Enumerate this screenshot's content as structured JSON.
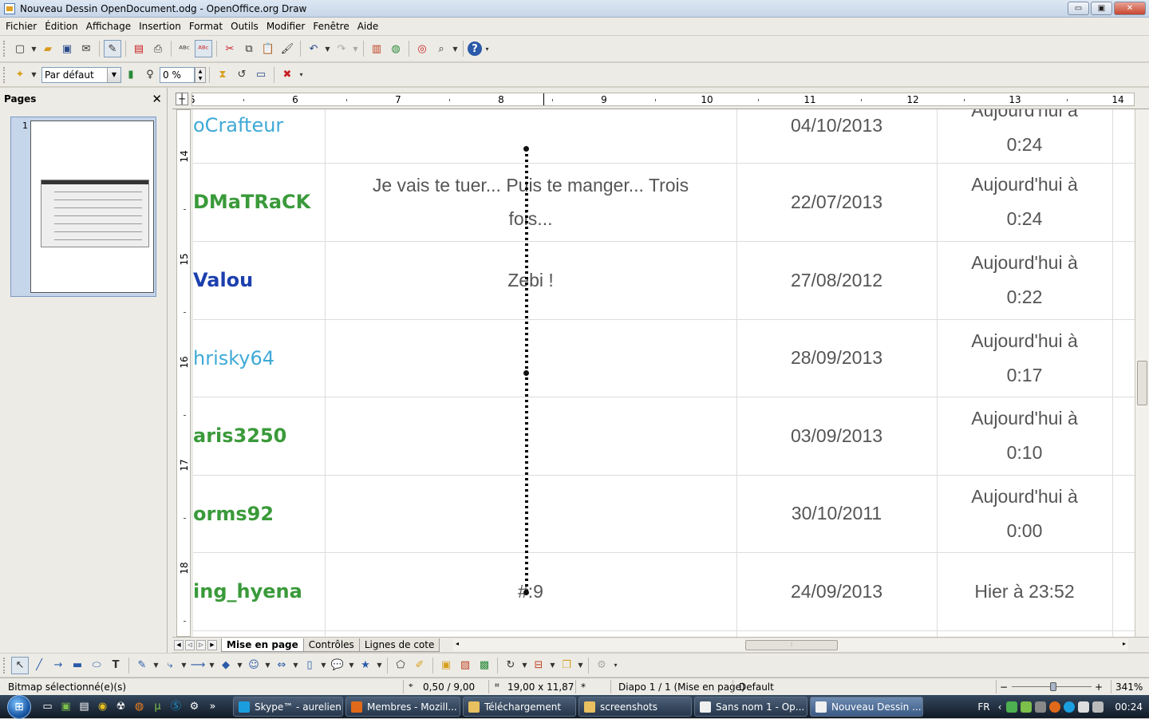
{
  "window": {
    "title": "Nouveau Dessin OpenDocument.odg - OpenOffice.org Draw",
    "btn_min": "▭",
    "btn_max": "▣",
    "btn_close": "✕"
  },
  "menu": [
    "Fichier",
    "Édition",
    "Affichage",
    "Insertion",
    "Format",
    "Outils",
    "Modifier",
    "Fenêtre",
    "Aide"
  ],
  "toolbar2": {
    "style_value": "Par défaut",
    "transparency_value": "0 %"
  },
  "pages_panel": {
    "title": "Pages",
    "close": "✕",
    "page_number": "1"
  },
  "ruler": {
    "h_labels": [
      "5",
      "6",
      "7",
      "8",
      "9",
      "10",
      "11",
      "12",
      "13",
      "14"
    ],
    "v_labels": [
      "14",
      "15",
      "16",
      "17",
      "18"
    ]
  },
  "table": {
    "rows": [
      {
        "user": "oCrafteur",
        "user_color": "#3fa9d6",
        "user_bold": false,
        "message": "",
        "date": "04/10/2013",
        "last_line1": "Aujourd'hui à",
        "last_line2": "0:24"
      },
      {
        "user": "DMaTRaCK",
        "user_color": "#3a9a3a",
        "user_bold": true,
        "message": "Je vais te tuer... Puis te manger... Trois fois...",
        "date": "22/07/2013",
        "last_line1": "Aujourd'hui à",
        "last_line2": "0:24"
      },
      {
        "user": "Valou",
        "user_color": "#1c3fae",
        "user_bold": true,
        "message": "Zebi !",
        "date": "27/08/2012",
        "last_line1": "Aujourd'hui à",
        "last_line2": "0:22"
      },
      {
        "user": "hrisky64",
        "user_color": "#3fa9d6",
        "user_bold": false,
        "message": "",
        "date": "28/09/2013",
        "last_line1": "Aujourd'hui à",
        "last_line2": "0:17"
      },
      {
        "user": "aris3250",
        "user_color": "#3a9a3a",
        "user_bold": true,
        "message": "",
        "date": "03/09/2013",
        "last_line1": "Aujourd'hui à",
        "last_line2": "0:10"
      },
      {
        "user": "orms92",
        "user_color": "#3a9a3a",
        "user_bold": true,
        "message": "",
        "date": "30/10/2011",
        "last_line1": "Aujourd'hui à",
        "last_line2": "0:00"
      },
      {
        "user": "ing_hyena",
        "user_color": "#3a9a3a",
        "user_bold": true,
        "message": "#:9",
        "date": "24/09/2013",
        "last_line1": "Hier à 23:52",
        "last_line2": ""
      }
    ]
  },
  "layer_tabs": [
    "Mise en page",
    "Contrôles",
    "Lignes de cote"
  ],
  "statusbar": {
    "selection": "Bitmap sélectionné(e)(s)",
    "position": "0,50 / 9,00",
    "size": "19,00 x 11,87",
    "modified": "*",
    "slide": "Diapo 1 / 1 (Mise en page)",
    "layout": "Default",
    "zoom_minus": "−",
    "zoom_plus": "+",
    "zoom": "341%"
  },
  "taskbar": {
    "tasks": [
      {
        "label": "Skype™ - aurelien...",
        "icon_color": "#1a9ee0"
      },
      {
        "label": "Membres - Mozill...",
        "icon_color": "#e06a1a"
      },
      {
        "label": "Téléchargement",
        "icon_color": "#e8c060"
      },
      {
        "label": "screenshots",
        "icon_color": "#e8c060"
      },
      {
        "label": "Sans nom 1 - Op...",
        "icon_color": "#f0f0f0"
      },
      {
        "label": "Nouveau Dessin ...",
        "icon_color": "#f0f0f0"
      }
    ],
    "lang": "FR",
    "clock": "00:24"
  },
  "colors": {
    "accent": "#3a9a3a",
    "link_blue": "#3fa9d6",
    "dark_blue": "#1c3fae"
  }
}
